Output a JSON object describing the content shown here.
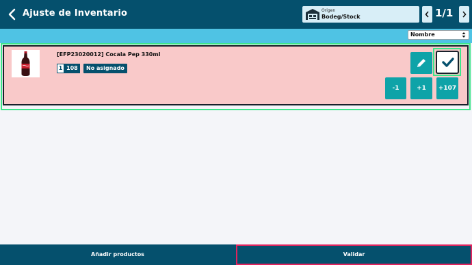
{
  "header": {
    "title": "Ajuste de Inventario",
    "origin_label": "Origen",
    "origin_value": "Bodeg/Stock",
    "pager": "1/1"
  },
  "sort": {
    "selected": "Nombre"
  },
  "product": {
    "name": "[EFP23020012] Cocala Pep 330ml",
    "qty_a": "1",
    "qty_b": "108",
    "tag": "No asignado",
    "actions": {
      "minus": "-1",
      "plus": "+1",
      "plus_all": "+107"
    }
  },
  "footer": {
    "add_label": "Añadir productos",
    "validate_label": "Validar"
  },
  "colors": {
    "topbar": "#05506d",
    "subbar": "#4fc3e4",
    "card_bg": "#f9c9c9",
    "action_teal": "#0ea3a8",
    "highlight_green": "#3ee68a",
    "highlight_red": "#e0245e"
  },
  "icons": [
    "back-chevron-icon",
    "warehouse-icon",
    "chevron-left-icon",
    "chevron-right-icon",
    "caret-updown-icon",
    "bottle-icon",
    "pencil-icon",
    "checkmark-icon"
  ]
}
